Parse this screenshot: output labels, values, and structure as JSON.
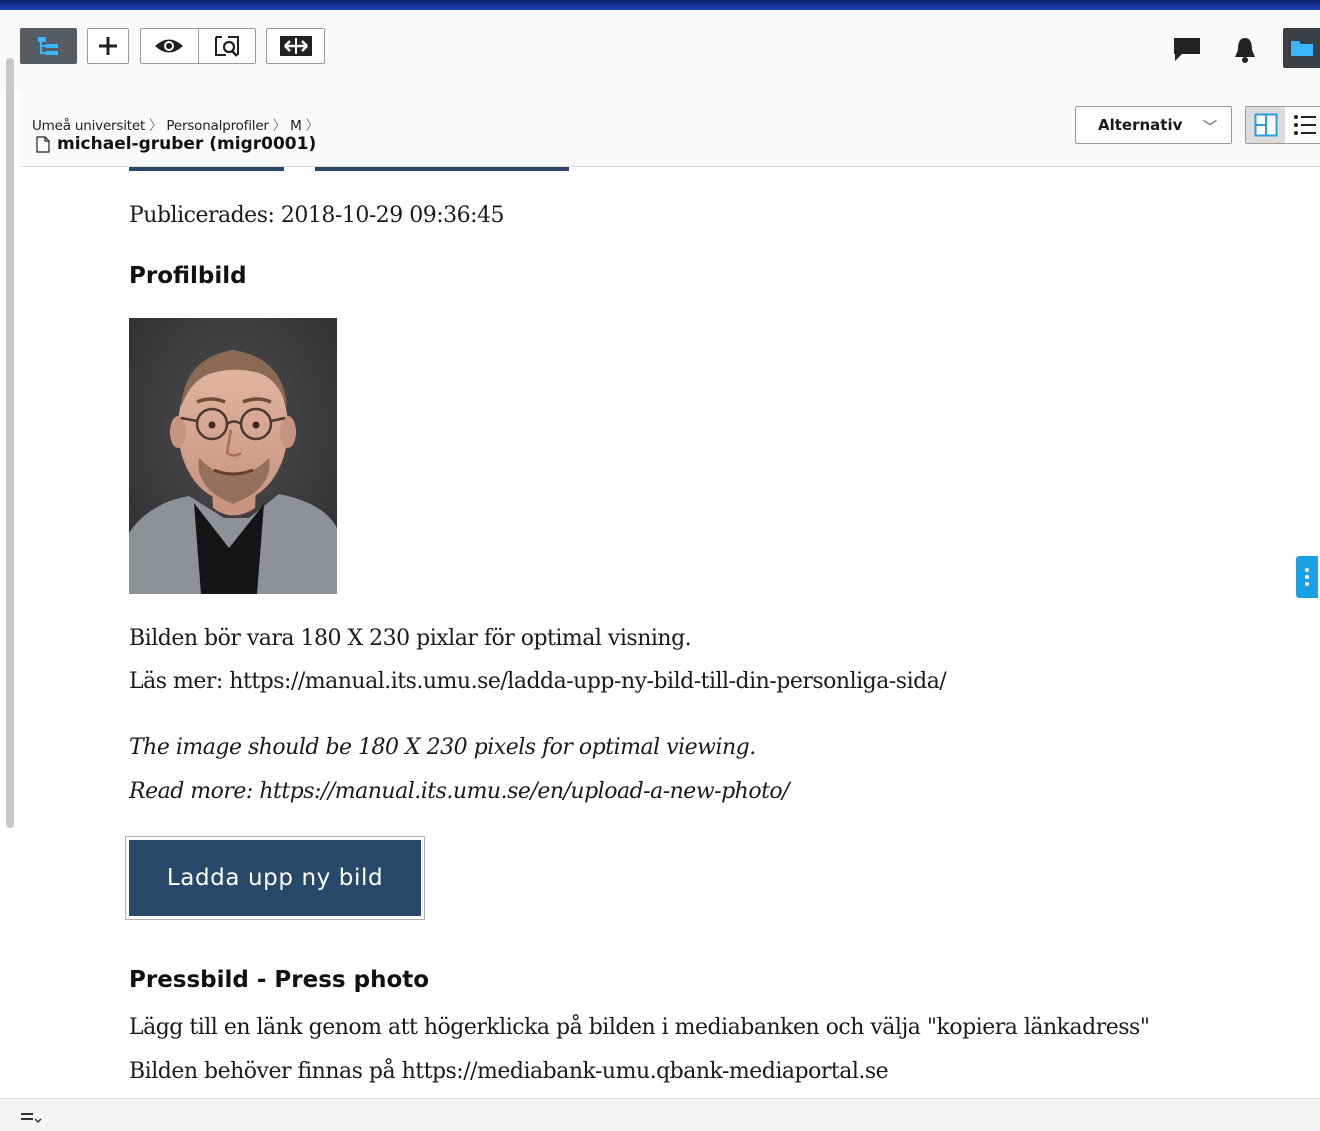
{
  "breadcrumb": {
    "items": [
      "Umeå universitet",
      "Personalprofiler",
      "M"
    ]
  },
  "page": {
    "name": "michael-gruber (migr0001)"
  },
  "options_select": {
    "label": "Alternativ"
  },
  "content": {
    "published": "Publicerades: 2018-10-29 09:36:45",
    "profile_heading": "Profilbild",
    "info_sv_1": "Bilden bör vara 180 X 230 pixlar för optimal visning.",
    "info_sv_2": "Läs mer: https://manual.its.umu.se/ladda-upp-ny-bild-till-din-personliga-sida/",
    "info_en_1": "The image should be 180 X 230 pixels for optimal viewing.",
    "info_en_2": "Read more: https://manual.its.umu.se/en/upload-a-new-photo/",
    "upload_button": "Ladda upp ny bild",
    "press_heading": "Pressbild - Press photo",
    "press_text_1": "Lägg till en länk genom att högerklicka på bilden i mediabanken och välja \"kopiera länkadress\"",
    "press_text_2": "Bilden behöver finnas på https://mediabank-umu.qbank-mediaportal.se"
  },
  "icons": {
    "toolbar": [
      "tree-icon",
      "plus-icon",
      "eye-icon",
      "preview-icon",
      "compare-icon"
    ],
    "toolbar_right": [
      "comment-icon",
      "bell-icon",
      "folder-icon"
    ],
    "view": [
      "split-view-icon",
      "list-view-icon"
    ]
  },
  "colors": {
    "accent": "#284869",
    "handle": "#1aa0e4",
    "top_stripe": "#1d43b8"
  }
}
